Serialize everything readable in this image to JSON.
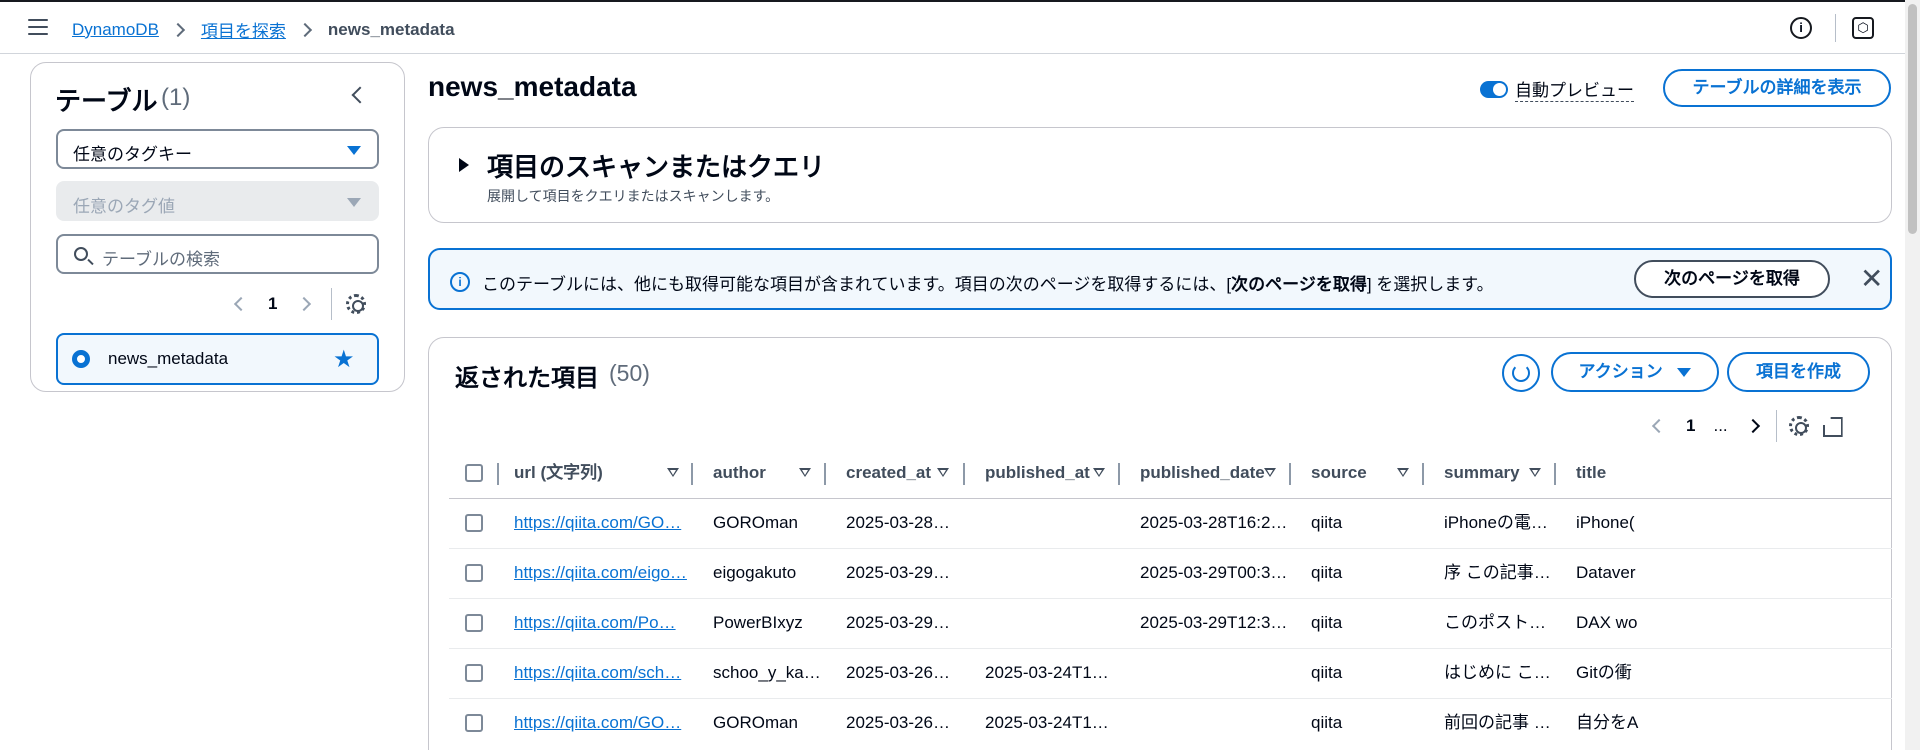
{
  "breadcrumb": {
    "root": "DynamoDB",
    "parent": "項目を探索",
    "current": "news_metadata"
  },
  "header_icons": {
    "info": "i",
    "settings": "⬡"
  },
  "left_panel": {
    "title": "テーブル",
    "count": "(1)",
    "tag_key_placeholder": "任意のタグキー",
    "tag_value_placeholder": "任意のタグ値",
    "search_placeholder": "テーブルの検索",
    "page": "1",
    "selected_table": "news_metadata"
  },
  "main": {
    "title": "news_metadata",
    "auto_preview_label": "自動プレビュー",
    "auto_preview_on": true,
    "details_button": "テーブルの詳細を表示",
    "scan_title": "項目のスキャンまたはクエリ",
    "scan_description": "展開して項目をクエリまたはスキャンします。",
    "alert_text_before": "このテーブルには、他にも取得可能な項目が含まれています。項目の次のページを取得するには、[",
    "alert_text_bold": "次のページを取得",
    "alert_text_after": "] を選択します。",
    "next_page_button": "次のページを取得",
    "items_title": "返された項目",
    "items_count": "(50)",
    "actions_button": "アクション",
    "create_item_button": "項目を作成",
    "page": "1",
    "page_ellipsis": "..."
  },
  "table": {
    "columns": [
      "url (文字列)",
      "author",
      "created_at",
      "published_at",
      "published_date",
      "source",
      "summary",
      "title"
    ],
    "rows": [
      [
        "https://qiita.com/GO…",
        "GOROman",
        "2025-03-28…",
        "",
        "2025-03-28T16:2…",
        "qiita",
        "iPhoneの電…",
        "iPhone("
      ],
      [
        "https://qiita.com/eigo…",
        "eigogakuto",
        "2025-03-29…",
        "",
        "2025-03-29T00:3…",
        "qiita",
        "序 この記事…",
        "Dataver"
      ],
      [
        "https://qiita.com/Po…",
        "PowerBIxyz",
        "2025-03-29…",
        "",
        "2025-03-29T12:3…",
        "qiita",
        "このポスト…",
        "DAX wo"
      ],
      [
        "https://qiita.com/sch…",
        "schoo_y_ka…",
        "2025-03-26…",
        "2025-03-24T1…",
        "",
        "qiita",
        "はじめに こ…",
        "Gitの衝"
      ],
      [
        "https://qiita.com/GO…",
        "GOROman",
        "2025-03-26…",
        "2025-03-24T1…",
        "",
        "qiita",
        "前回の記事 …",
        "自分をA"
      ]
    ]
  }
}
